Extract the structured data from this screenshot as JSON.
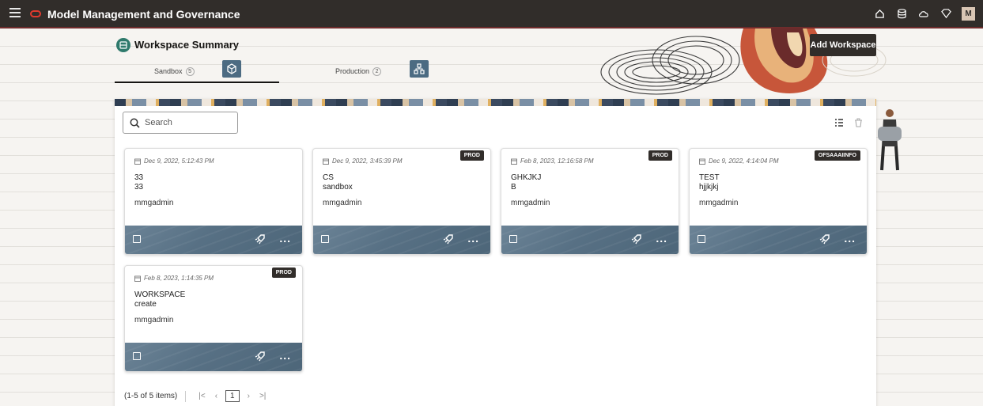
{
  "header": {
    "app_title": "Model Management and Governance",
    "avatar_initial": "M"
  },
  "summary": {
    "title": "Workspace Summary",
    "add_button": "Add Workspace",
    "tabs": [
      {
        "label": "Sandbox",
        "count": "5",
        "active": true
      },
      {
        "label": "Production",
        "count": "2",
        "active": false
      }
    ]
  },
  "search": {
    "placeholder": "Search"
  },
  "cards": [
    {
      "date": "Dec 9, 2022, 5:12:43 PM",
      "badge": "",
      "name": "33",
      "desc": "33",
      "owner": "mmgadmin"
    },
    {
      "date": "Dec 9, 2022, 3:45:39 PM",
      "badge": "PROD",
      "name": "CS",
      "desc": "sandbox",
      "owner": "mmgadmin"
    },
    {
      "date": "Feb 8, 2023, 12:16:58 PM",
      "badge": "PROD",
      "name": "GHKJKJ",
      "desc": "B",
      "owner": "mmgadmin"
    },
    {
      "date": "Dec 9, 2022, 4:14:04 PM",
      "badge": "OFSAAAIINFO",
      "name": "TEST",
      "desc": "hjjkjkj",
      "owner": "mmgadmin"
    },
    {
      "date": "Feb 8, 2023, 1:14:35 PM",
      "badge": "PROD",
      "name": "WORKSPACE",
      "desc": "create",
      "owner": "mmgadmin"
    }
  ],
  "pager": {
    "summary": "(1-5 of 5 items)",
    "current_page": "1",
    "first": "|<",
    "prev": "‹",
    "next": "›",
    "last": ">|"
  },
  "card_more_label": "...",
  "colors": {
    "topbar": "#312d2a",
    "accent": "#4c6b82",
    "brand_red": "#e03a2e"
  },
  "icons": [
    "hamburger-icon",
    "oracle-logo",
    "home-icon",
    "database-icon",
    "cloud-icon",
    "shield-icon",
    "workspace-icon",
    "sandbox-tab-icon",
    "production-tab-icon",
    "search-icon",
    "list-view-icon",
    "delete-icon",
    "calendar-icon",
    "deploy-icon"
  ]
}
